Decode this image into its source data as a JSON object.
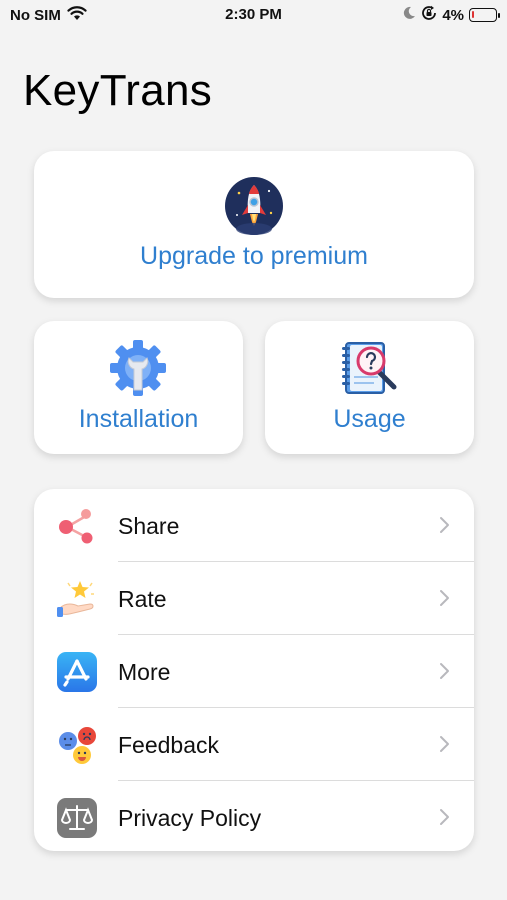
{
  "status_bar": {
    "carrier": "No SIM",
    "time": "2:30 PM",
    "battery": "4%"
  },
  "app_title": "KeyTrans",
  "upgrade": {
    "label": "Upgrade to premium",
    "icon": "rocket-icon"
  },
  "installation": {
    "label": "Installation",
    "icon": "gear-wrench-icon"
  },
  "usage": {
    "label": "Usage",
    "icon": "notebook-magnifier-icon"
  },
  "menu": {
    "items": [
      {
        "label": "Share",
        "icon": "share-icon"
      },
      {
        "label": "Rate",
        "icon": "rate-star-icon"
      },
      {
        "label": "More",
        "icon": "app-store-icon"
      },
      {
        "label": "Feedback",
        "icon": "feedback-emoji-icon"
      },
      {
        "label": "Privacy Policy",
        "icon": "scales-icon"
      }
    ]
  },
  "colors": {
    "accent": "#2f7fcf",
    "background": "#f3f3f3",
    "card": "#ffffff"
  }
}
